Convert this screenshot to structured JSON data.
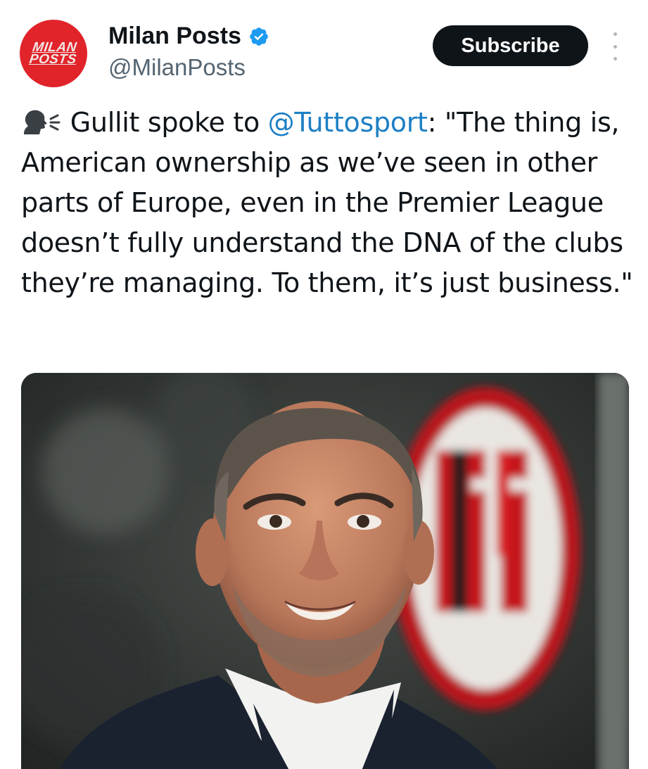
{
  "account": {
    "avatar_text_line1": "MILAN",
    "avatar_text_line2": "POSTS",
    "display_name": "Milan Posts",
    "handle": "@MilanPosts",
    "verified_icon": "verified-badge-icon"
  },
  "actions": {
    "subscribe_label": "Subscribe",
    "more_icon": "more-vertical-icon"
  },
  "tweet": {
    "icon": "speaking-head-icon",
    "text_before_mention": "Gullit spoke to ",
    "mention": "@Tuttosport",
    "text_after_mention": ": \"The thing is, American ownership as we’ve seen in other parts of Europe, even in the Premier League doesn’t fully understand the DNA of the clubs they’re managing. To them, it’s just business.\""
  },
  "media": {
    "icon": "photo-of-man-with-ac-milan-crest"
  },
  "colors": {
    "brand_red": "#e0242a",
    "mention_blue": "#1d7fc4",
    "verified_blue": "#1d9bf0",
    "button_dark": "#0f1419",
    "handle_grey": "#536471"
  }
}
